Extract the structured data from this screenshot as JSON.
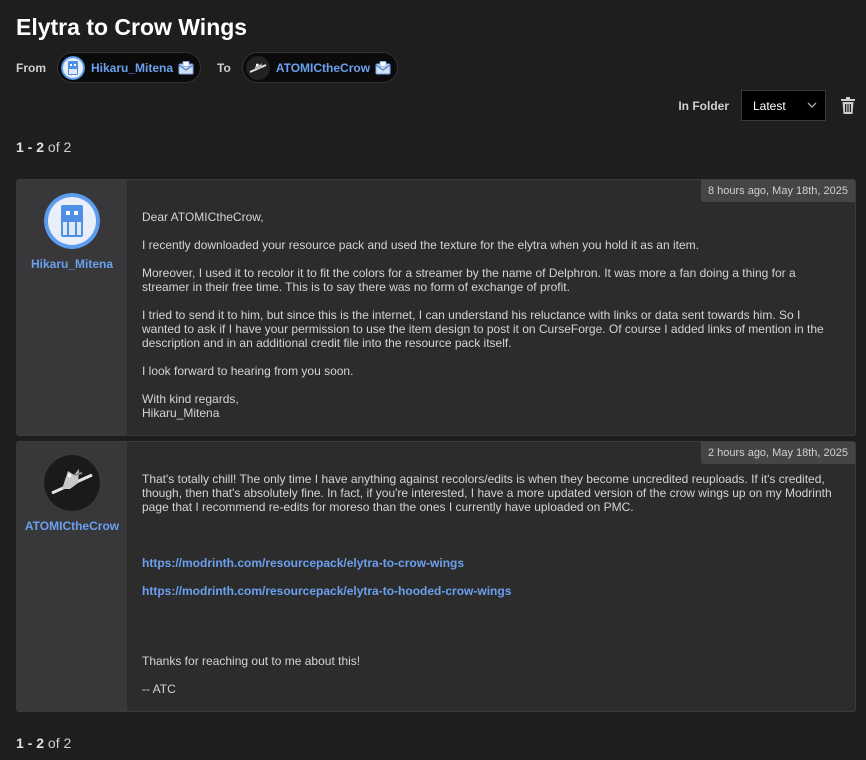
{
  "conversation": {
    "title": "Elytra to Crow Wings",
    "from_label": "From",
    "to_label": "To",
    "from_user": "Hikaru_Mitena",
    "to_user": "ATOMICtheCrow"
  },
  "folder": {
    "label": "In Folder",
    "selected": "Latest"
  },
  "pagination": {
    "range": "1 - 2",
    "of_text": "of 2"
  },
  "messages": [
    {
      "author": "Hikaru_Mitena",
      "timestamp": "8 hours ago, May 18th, 2025",
      "paragraphs": [
        "Dear ATOMICtheCrow,",
        "I recently downloaded your resource pack and used the texture for the elytra when you hold it as an item.",
        "Moreover, I used it to recolor it to fit the colors for a streamer by the name of Delphron. It was more a fan doing a thing for a streamer in their free time. This is to say there was no form of exchange of profit.",
        "I tried to send it to him, but since this is the internet, I can understand his reluctance with links or data sent towards him. So I wanted to ask if I have your permission to use the item design to post it on CurseForge. Of course I added links of mention in the description and in an additional credit file into the resource pack itself.",
        "I look forward to hearing from you soon.",
        "With kind regards,",
        "Hikaru_Mitena"
      ]
    },
    {
      "author": "ATOMICtheCrow",
      "timestamp": "2 hours ago, May 18th, 2025",
      "paragraphs": [
        "That's totally chill! The only time I have anything against recolors/edits is when they become uncredited reuploads. If it's credited, though, then that's absolutely fine. In fact, if you're interested, I have a more updated version of the crow wings up on my Modrinth page that I recommend re-edits for moreso than the ones I currently have uploaded on PMC.",
        "Thanks for reaching out to me about this!",
        "-- ATC"
      ],
      "links": [
        "https://modrinth.com/resourcepack/elytra-to-crow-wings",
        "https://modrinth.com/resourcepack/elytra-to-hooded-crow-wings"
      ]
    }
  ],
  "colors": {
    "background": "#1e1e1f",
    "card": "#2c2c2d",
    "sidebar": "#38383a",
    "link": "#6ba0ee"
  }
}
